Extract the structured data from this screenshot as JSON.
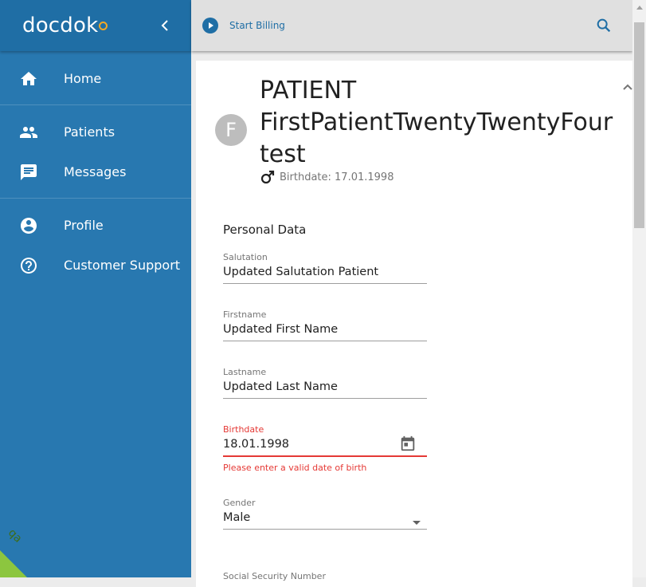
{
  "app": {
    "brand": "docdok"
  },
  "sidebar": {
    "items": [
      {
        "label": "Home",
        "icon": "home-icon"
      },
      {
        "label": "Patients",
        "icon": "people-icon"
      },
      {
        "label": "Messages",
        "icon": "message-icon"
      },
      {
        "label": "Profile",
        "icon": "account-circle-icon"
      },
      {
        "label": "Customer Support",
        "icon": "help-circle-icon"
      }
    ],
    "env_badge": "qa"
  },
  "topbar": {
    "start_billing": "Start Billing"
  },
  "patient": {
    "avatar_initial": "F",
    "title": "PATIENT FirstPatientTwentyTwentyFour test",
    "birthdate_line": "Birthdate: 17.01.1998"
  },
  "form": {
    "section_title": "Personal Data",
    "salutation": {
      "label": "Salutation",
      "value": "Updated Salutation Patient"
    },
    "firstname": {
      "label": "Firstname",
      "value": "Updated First Name"
    },
    "lastname": {
      "label": "Lastname",
      "value": "Updated Last Name"
    },
    "birthdate": {
      "label": "Birthdate",
      "value": "18.01.1998",
      "error": "Please enter a valid date of birth"
    },
    "gender": {
      "label": "Gender",
      "value": "Male"
    },
    "next_label": "Social Security Number"
  },
  "colors": {
    "sidebar": "#2878b0",
    "accent": "#1f6ea5",
    "error": "#e53935",
    "badge": "#8cc63f"
  }
}
